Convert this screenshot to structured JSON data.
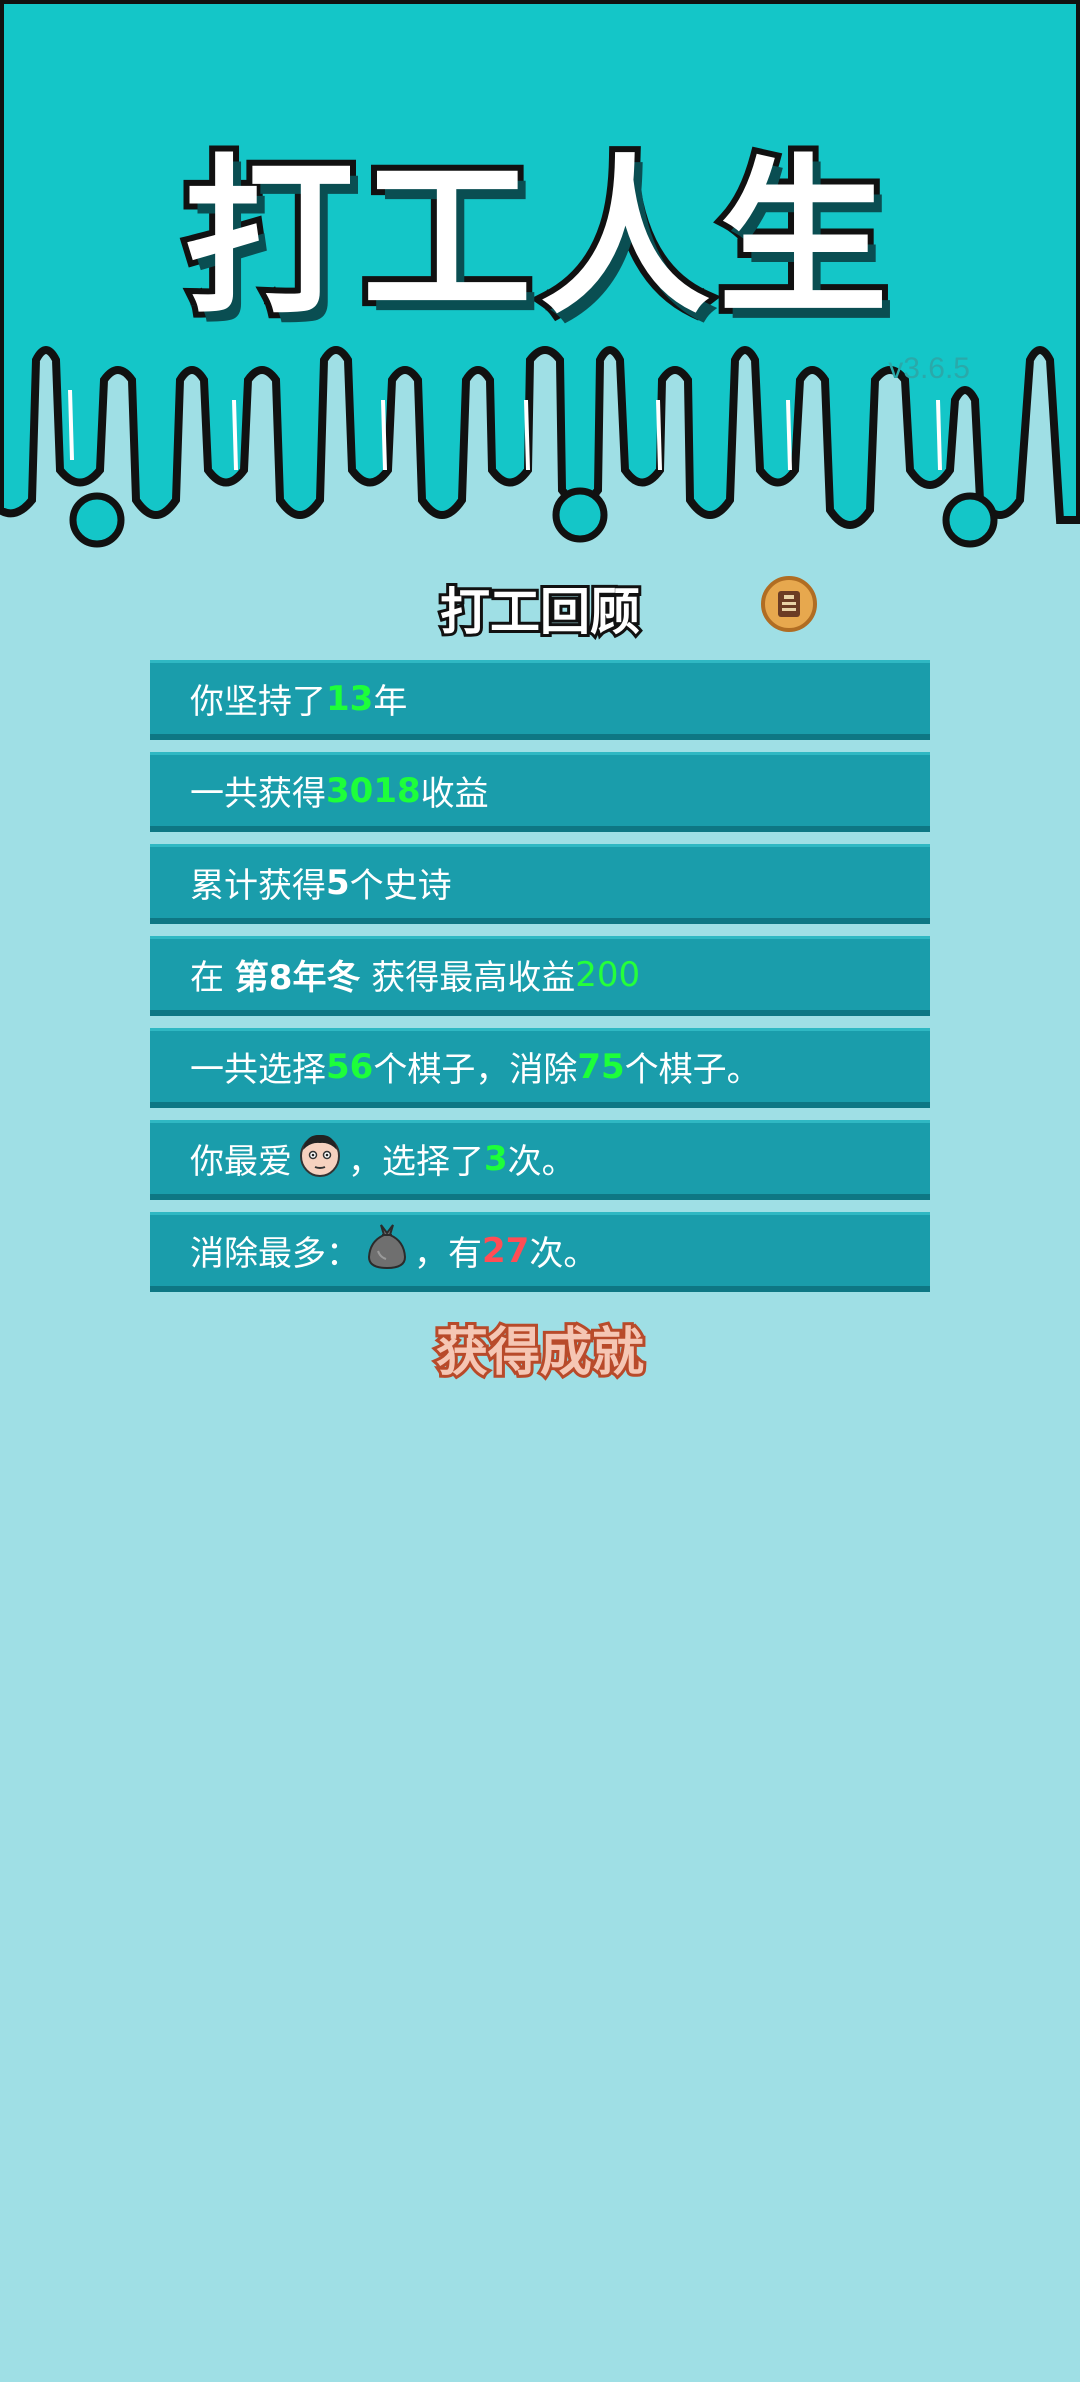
{
  "header": {
    "title": "打工人生",
    "version": "v3.6.5",
    "colors": {
      "sky": "#14c6c8",
      "ground": "#9fdfe5"
    }
  },
  "review": {
    "title": "打工回顾",
    "badge_icon": "vest-icon",
    "rows": [
      {
        "parts": [
          "你坚持了",
          "13",
          "年"
        ]
      },
      {
        "parts": [
          "一共获得",
          "3018",
          "收益"
        ]
      },
      {
        "parts": [
          "累计获得",
          "5",
          "个史诗"
        ]
      },
      {
        "parts": [
          "在 ",
          "第8年冬",
          " 获得最高收益",
          "200"
        ]
      },
      {
        "parts": [
          "一共选择",
          "56",
          "个棋子，消除",
          "75",
          "个棋子。"
        ]
      },
      {
        "parts": [
          "你最爱",
          "，选择了",
          "3",
          "次。"
        ],
        "icon": "worker-face-icon"
      },
      {
        "parts": [
          "消除最多：",
          "，有",
          "27",
          "次。"
        ],
        "icon": "trash-bag-icon"
      }
    ]
  },
  "achievement": {
    "label": "获得成就"
  }
}
